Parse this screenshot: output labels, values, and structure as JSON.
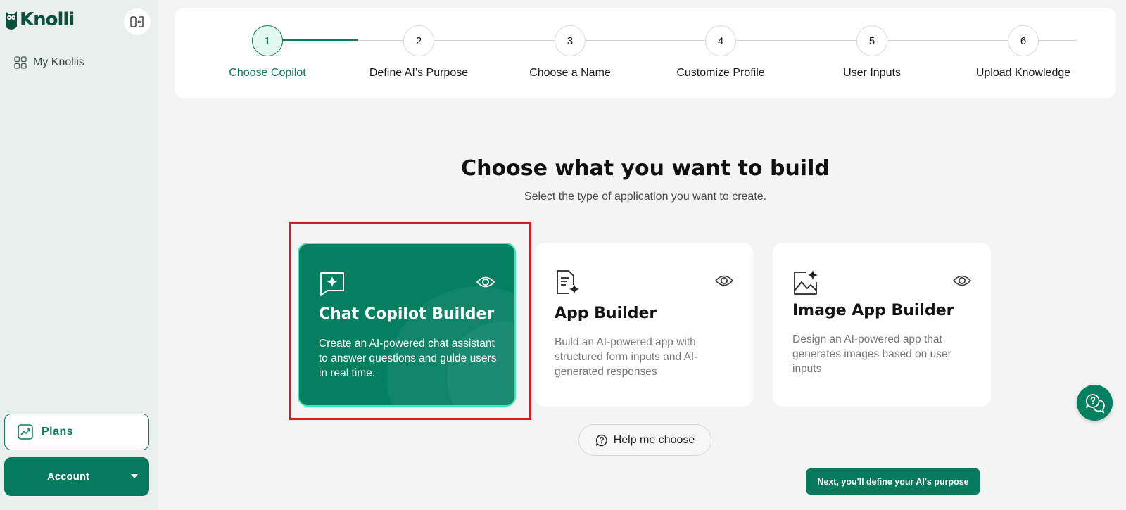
{
  "brand": {
    "name": "Knolli"
  },
  "sidebar": {
    "nav_items": [
      {
        "label": "My Knollis",
        "icon": "grid-icon"
      }
    ],
    "plans_label": "Plans",
    "account_label": "Account"
  },
  "stepper": {
    "steps": [
      {
        "number": "1",
        "label": "Choose Copilot",
        "active": true
      },
      {
        "number": "2",
        "label": "Define AI’s Purpose",
        "active": false
      },
      {
        "number": "3",
        "label": "Choose a Name",
        "active": false
      },
      {
        "number": "4",
        "label": "Customize Profile",
        "active": false
      },
      {
        "number": "5",
        "label": "User Inputs",
        "active": false
      },
      {
        "number": "6",
        "label": "Upload Knowledge",
        "active": false
      }
    ]
  },
  "main": {
    "title": "Choose what you want to build",
    "subtitle": "Select the type of application you want to create.",
    "cards": [
      {
        "title": "Chat Copilot Builder",
        "description": "Create an AI-powered chat assistant to answer questions and guide users in real time.",
        "icon": "chat-sparkle-icon",
        "selected": true
      },
      {
        "title": "App Builder",
        "description": "Build an AI-powered app with structured form inputs and AI-generated responses",
        "icon": "document-sparkle-icon",
        "selected": false
      },
      {
        "title": "Image App Builder",
        "description": "Design an AI-powered app that generates images based on user inputs",
        "icon": "image-sparkle-icon",
        "selected": false
      }
    ],
    "help_label": "Help me choose",
    "next_label": "Next, you'll define your AI's purpose"
  },
  "colors": {
    "brand_green": "#057a5c",
    "selected_border": "#3ce8b6",
    "highlight_red": "#d6181f",
    "sidebar_bg": "#e8efed"
  }
}
